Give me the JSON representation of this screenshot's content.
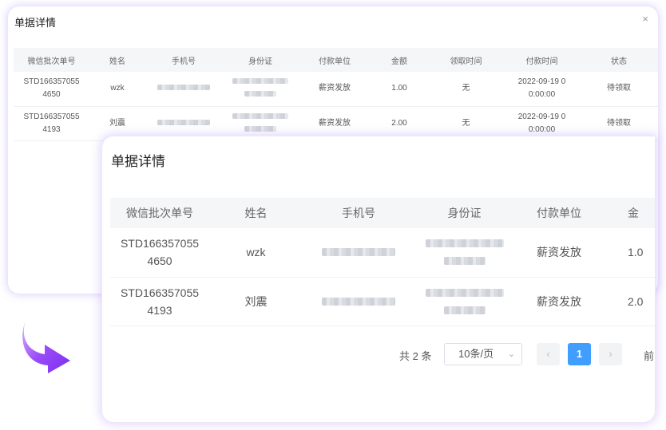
{
  "back_dialog": {
    "title": "单据详情",
    "close_icon": "×",
    "columns": [
      "微信批次单号",
      "姓名",
      "手机号",
      "身份证",
      "付款单位",
      "金额",
      "领取时间",
      "付款时间",
      "状态"
    ],
    "rows": [
      {
        "batch_l1": "STD166357055",
        "batch_l2": "4650",
        "name": "wzk",
        "unit": "薪资发放",
        "amount": "1.00",
        "receive_time": "无",
        "pay_l1": "2022-09-19 0",
        "pay_l2": "0:00:00",
        "status": "待领取"
      },
      {
        "batch_l1": "STD166357055",
        "batch_l2": "4193",
        "name": "刘震",
        "unit": "薪资发放",
        "amount": "2.00",
        "receive_time": "无",
        "pay_l1": "2022-09-19 0",
        "pay_l2": "0:00:00",
        "status": "待领取"
      }
    ]
  },
  "front_dialog": {
    "title": "单据详情",
    "columns": [
      "微信批次单号",
      "姓名",
      "手机号",
      "身份证",
      "付款单位",
      "金"
    ],
    "rows": [
      {
        "batch_l1": "STD166357055",
        "batch_l2": "4650",
        "name": "wzk",
        "unit": "薪资发放",
        "amount": "1.0"
      },
      {
        "batch_l1": "STD166357055",
        "batch_l2": "4193",
        "name": "刘震",
        "unit": "薪资发放",
        "amount": "2.0"
      }
    ],
    "pagination": {
      "total": "共 2 条",
      "page_size": "10条/页",
      "prev_icon": "‹",
      "current_page": "1",
      "next_icon": "›",
      "goto_label": "前"
    }
  },
  "colors": {
    "accent": "#409eff",
    "arrow_purple": "#8b3cf7",
    "glow": "#a88cf0"
  },
  "icons": {
    "arrow": "curved-arrow-icon"
  }
}
